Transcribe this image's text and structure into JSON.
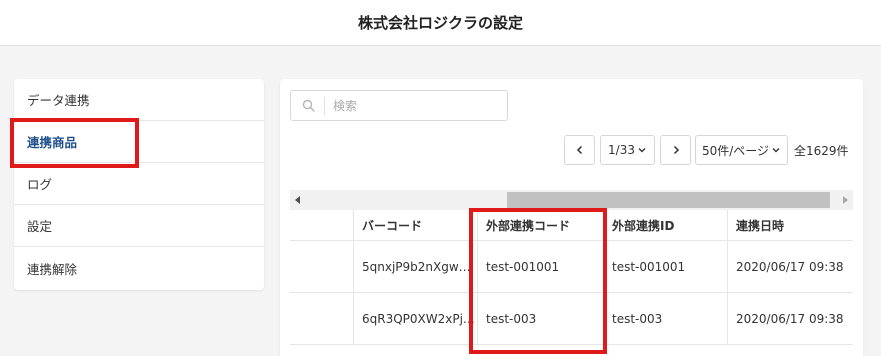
{
  "header": {
    "title": "株式会社ロジクラの設定"
  },
  "sidebar": {
    "items": [
      {
        "label": "データ連携"
      },
      {
        "label": "連携商品"
      },
      {
        "label": "ログ"
      },
      {
        "label": "設定"
      },
      {
        "label": "連携解除"
      }
    ]
  },
  "search": {
    "placeholder": "検索",
    "value": "",
    "icon": "search-icon"
  },
  "pagination": {
    "prev_icon": "chevron-left-icon",
    "page": "1/33",
    "next_icon": "chevron-right-icon",
    "per_page": "50件/ページ",
    "total": "全1629件"
  },
  "table": {
    "columns": [
      "",
      "バーコード",
      "外部連携コード",
      "外部連携ID",
      "連携日時"
    ],
    "rows": [
      [
        "",
        "5qnxjP9b2nXgw…",
        "test-001001",
        "test-001001",
        "2020/06/17 09:38"
      ],
      [
        "",
        "6qR3QP0XW2xPj…",
        "test-003",
        "test-003",
        "2020/06/17 09:38"
      ]
    ]
  },
  "colors": {
    "accent": "#1f4f8a",
    "highlight": "#e01a1a"
  }
}
